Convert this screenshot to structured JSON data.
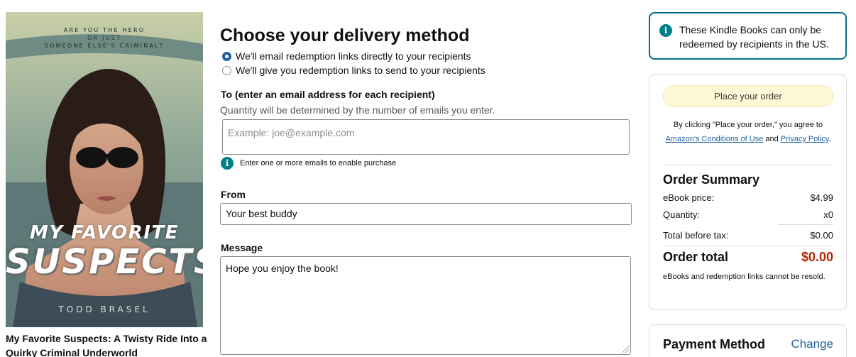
{
  "book": {
    "cover_tagline": "ARE YOU THE HERO\nOR JUST\nSOMEONE ELSE'S CRIMINAL?",
    "cover_title_line1": "MY FAVORITE",
    "cover_title_line2": "SUSPECTS",
    "cover_author": "TODD BRASEL",
    "caption": "My Favorite Suspects: A Twisty Ride Into a Quirky Criminal Underworld"
  },
  "delivery": {
    "heading": "Choose your delivery method",
    "options": [
      {
        "label": "We'll email redemption links directly to your recipients",
        "selected": true
      },
      {
        "label": "We'll give you redemption links to send to your recipients",
        "selected": false
      }
    ]
  },
  "to_field": {
    "label": "To (enter an email address for each recipient)",
    "hint": "Quantity will be determined by the number of emails you enter.",
    "placeholder": "Example: joe@example.com",
    "value": "",
    "info_text": "Enter one or more emails to enable purchase"
  },
  "from_field": {
    "label": "From",
    "value": "Your best buddy"
  },
  "message_field": {
    "label": "Message",
    "value": "Hope you enjoy the book!"
  },
  "alert": {
    "text": "These Kindle Books can only be redeemed by recipients in the US."
  },
  "order": {
    "place_order_label": "Place your order",
    "agree_prefix": "By clicking \"Place your order,\" you agree to",
    "conditions_link": "Amazon's Conditions of Use",
    "and_text": "and",
    "privacy_link": "Privacy Policy",
    "period": ".",
    "summary_title": "Order Summary",
    "rows": [
      {
        "label": "eBook price:",
        "value": "$4.99"
      },
      {
        "label": "Quantity:",
        "value": "x0"
      },
      {
        "label": "Total before tax:",
        "value": "$0.00"
      }
    ],
    "total_label": "Order total",
    "total_value": "$0.00",
    "note": "eBooks and redemption links cannot be resold."
  },
  "payment": {
    "title": "Payment Method",
    "change_label": "Change"
  },
  "colors": {
    "link": "#2162a1",
    "teal": "#007185",
    "info_icon": "#00818a",
    "price_red": "#b12704",
    "place_order_bg": "#fff8d6"
  },
  "icons": {
    "info": "info-circle-icon",
    "radio_checked": "radio-checked-icon",
    "radio_unchecked": "radio-unchecked-icon"
  }
}
